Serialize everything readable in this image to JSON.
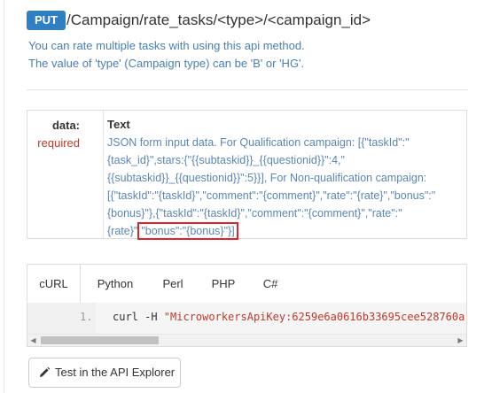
{
  "endpoint": {
    "method": "PUT",
    "path": "/Campaign/rate_tasks/<type>/<campaign_id>",
    "description_line1": "You can rate multiple tasks with using this api method.",
    "description_line2": "The value of 'type' (Campaign type) can be 'B' or 'HG'."
  },
  "param": {
    "name": "data:",
    "required": "required",
    "type": "Text",
    "desc_line1": "JSON form input data. For Qualification campaign: [{\"taskId\":\"",
    "desc_line2": "{task_id}\",stars:{\"{{subtaskid}}_{{questionid}}\":4,\"",
    "desc_line3": "{{subtaskid}}_{{questionid}}\":5}}], For Non-qualification campaign:",
    "desc_line4": "[{\"taskId\":\"{taskId}\",\"comment\":\"{comment}\",\"rate\":\"{rate}\",\"bonus\":\"",
    "desc_line5_pre": "{bonus}\"},{\"taskId\":\"{taskId}\",\"comment\":\"{comment}\",\"rate\":\"",
    "desc_line6_pre": "{rate}\"",
    "desc_line6_highlight": "\"bonus\":\"{bonus}\"}]"
  },
  "code_tabs": {
    "tabs": [
      "cURL",
      "Python",
      "Perl",
      "PHP",
      "C#"
    ],
    "active": "cURL",
    "line_number": "1.",
    "code_cmd": "curl -H ",
    "code_str": "\"MicroworkersApiKey:6259e6a0616b33695cee528760a"
  },
  "explorer_button": {
    "label": "Test in the API Explorer",
    "icon": "pencil-icon"
  },
  "colors": {
    "method_badge": "#2f7fc1",
    "description": "#4a7fb0",
    "required": "#c0392b",
    "highlight_border": "#e0222a"
  }
}
